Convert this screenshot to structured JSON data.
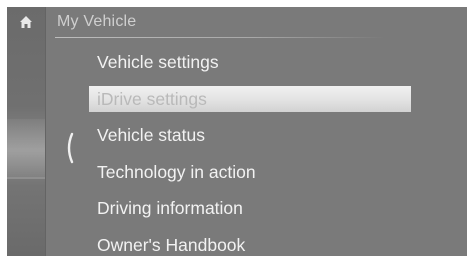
{
  "header": {
    "title": "My Vehicle",
    "home_icon": "home-icon"
  },
  "navigation": {
    "back_icon": "chevron-left-icon"
  },
  "menu": {
    "items": [
      {
        "label": "Vehicle settings",
        "selected": false
      },
      {
        "label": "iDrive settings",
        "selected": true
      },
      {
        "label": "Vehicle status",
        "selected": false
      },
      {
        "label": "Technology in action",
        "selected": false
      },
      {
        "label": "Driving information",
        "selected": false
      },
      {
        "label": "Owner's Handbook",
        "selected": false
      }
    ]
  },
  "colors": {
    "background": "#7a7a7a",
    "text": "#f2f2f2",
    "highlight": "#e6e6e6",
    "highlight_text": "#b9b9b9"
  }
}
